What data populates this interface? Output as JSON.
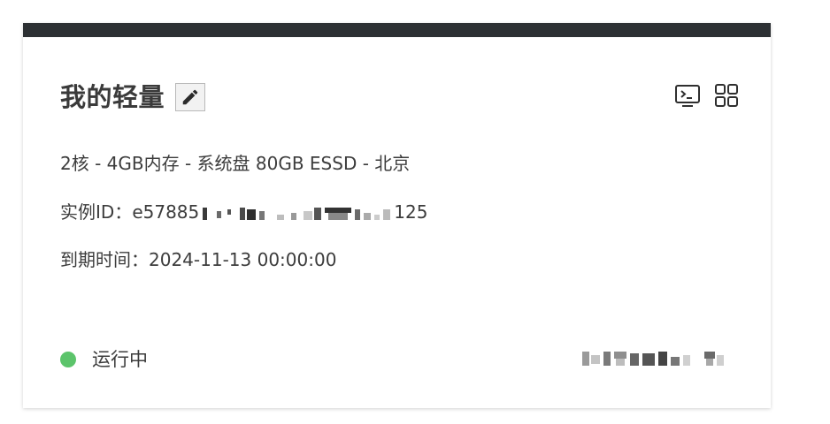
{
  "card": {
    "title": "我的轻量",
    "spec": "2核 - 4GB内存 - 系统盘 80GB ESSD - 北京",
    "instance_id_label": "实例ID：",
    "instance_id_prefix": "e57885",
    "instance_id_suffix": "125",
    "expire_label": "到期时间：",
    "expire_value": "2024-11-13 00:00:00",
    "status_text": "运行中"
  },
  "icons": {
    "edit": "pencil-icon",
    "terminal": "terminal-icon",
    "apps": "grid-icon"
  },
  "colors": {
    "topbar": "#2c3033",
    "status_running": "#5cc46b",
    "text": "#3c3c3c"
  }
}
